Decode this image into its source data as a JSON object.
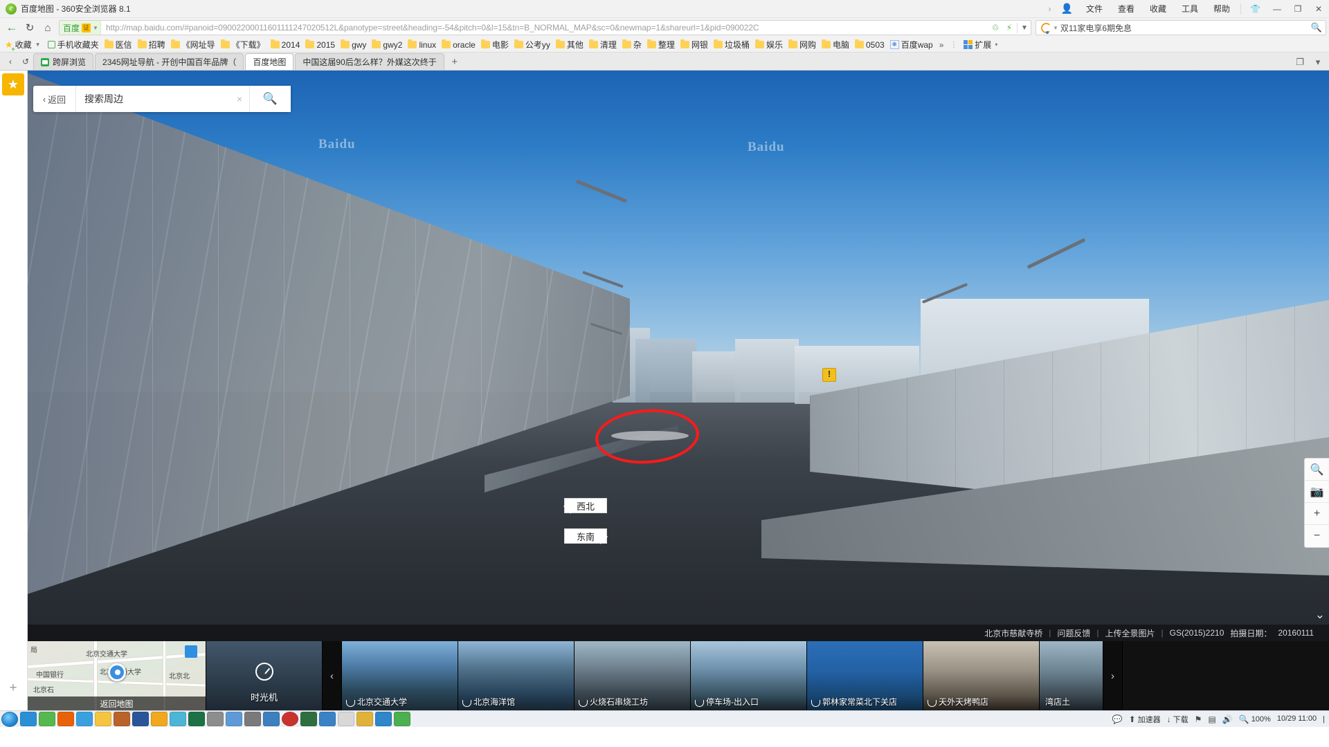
{
  "window": {
    "title": "百度地图 - 360安全浏览器 8.1",
    "app_icon": "ie-browser-icon",
    "menus": [
      "文件",
      "查看",
      "收藏",
      "工具",
      "帮助"
    ],
    "user_icon": "user-account-icon",
    "chevron": "›",
    "skin_icon": "shirt-skin-icon",
    "minimize": "—",
    "maximize": "❐",
    "close": "✕"
  },
  "nav": {
    "back_icon": "back-arrow-icon",
    "reload_icon": "reload-icon",
    "home_icon": "home-icon",
    "security_label": "百度",
    "security_badge": "证",
    "url_prefix": "http://map.",
    "url_domain": "baidu.com",
    "url_rest": "/#panoid=09002200011601111247020512L&panotype=street&heading=-54&pitch=0&l=15&tn=B_NORMAL_MAP&sc=0&newmap=1&shareurl=1&pid=090022C",
    "url_full": "http://map.baidu.com/#panoid=09002200011601111247020512L&panotype=street&heading=-54&pitch=0&l=15&tn=B_NORMAL_MAP&sc=0&newmap=1&shareurl=1&pid=090022C",
    "translate_icon": "translate-icon",
    "speed_icon": "lightning-icon",
    "dropdown_icon": "chevron-down-icon",
    "search_engine_icon": "baidu-logo-icon",
    "search_value": "双11家电享6期免息",
    "search_go_icon": "search-icon"
  },
  "bookmarks": {
    "favorites_label": "收藏",
    "favorites_icon": "star-icon",
    "caret_icon": "chevron-down-icon",
    "mobile_label": "手机收藏夹",
    "mobile_icon": "mobile-bookmark-icon",
    "items": [
      {
        "label": "医信",
        "icon": "folder-icon"
      },
      {
        "label": "招聘",
        "icon": "folder-icon"
      },
      {
        "label": "《网址导",
        "icon": "folder-icon"
      },
      {
        "label": "《下载》",
        "icon": "folder-icon"
      },
      {
        "label": "2014",
        "icon": "folder-icon"
      },
      {
        "label": "2015",
        "icon": "folder-icon"
      },
      {
        "label": "gwy",
        "icon": "folder-icon"
      },
      {
        "label": "gwy2",
        "icon": "folder-icon"
      },
      {
        "label": "linux",
        "icon": "folder-icon"
      },
      {
        "label": "oracle",
        "icon": "folder-icon"
      },
      {
        "label": "电影",
        "icon": "folder-icon"
      },
      {
        "label": "公考yy",
        "icon": "folder-icon"
      },
      {
        "label": "其他",
        "icon": "folder-icon"
      },
      {
        "label": "清理",
        "icon": "folder-icon"
      },
      {
        "label": "杂",
        "icon": "folder-icon"
      },
      {
        "label": "整理",
        "icon": "folder-icon"
      },
      {
        "label": "网银",
        "icon": "folder-icon"
      },
      {
        "label": "垃圾桶",
        "icon": "folder-icon"
      },
      {
        "label": "娱乐",
        "icon": "folder-icon"
      },
      {
        "label": "网购",
        "icon": "folder-icon"
      },
      {
        "label": "电脑",
        "icon": "folder-icon"
      },
      {
        "label": "0503",
        "icon": "folder-icon"
      },
      {
        "label": "百度wap",
        "icon": "baidu-site-icon"
      }
    ],
    "overflow_icon": "»",
    "extensions_label": "扩展",
    "extensions_icon": "extensions-icon",
    "extensions_caret": "▾"
  },
  "tabs": {
    "nav_left_icon": "tab-scroll-left-icon",
    "restore_icon": "restore-tab-icon",
    "items": [
      {
        "label": "跨屏浏览",
        "favicon": "crossscreen-icon",
        "active": false
      },
      {
        "label": "2345网址导航 - 开创中国百年品牌（",
        "favicon": "site-icon",
        "active": false
      },
      {
        "label": "百度地图",
        "favicon": "site-icon",
        "active": true
      },
      {
        "label": "中国这届90后怎么样？外媒这次终于",
        "favicon": "site-icon",
        "active": false
      }
    ],
    "new_tab_icon": "+",
    "right_icons": [
      "window-restore-icon",
      "tab-list-icon"
    ]
  },
  "map": {
    "search": {
      "back_label": "返回",
      "back_icon": "chevron-left-icon",
      "placeholder": "搜索周边",
      "value": "搜索周边",
      "clear_icon": "×",
      "go_icon": "search-icon"
    },
    "compass": {
      "nw_label": "西北",
      "se_label": "东南"
    },
    "watermark": [
      "Baidu",
      "Baidu"
    ],
    "warning_icon": "warning-triangle-icon",
    "annotation": "red-ellipse-annotation",
    "right_tools": [
      {
        "name": "search-tool",
        "icon": "🔍"
      },
      {
        "name": "camera-tool",
        "icon": "📷"
      },
      {
        "name": "zoom-in",
        "icon": "+"
      },
      {
        "name": "zoom-out",
        "icon": "−"
      },
      {
        "name": "collapse-down",
        "icon": "⌄"
      }
    ],
    "status": {
      "location": "北京市慈献寺桥",
      "feedback": "问题反馈",
      "upload": "上传全景图片",
      "license": "GS(2015)2210",
      "date_label": "拍摄日期：",
      "date_value": "20160111",
      "separator": "|"
    },
    "thumbnails": {
      "prev_icon": "‹",
      "next_icon": "›",
      "map_card": {
        "back_label": "返回地图",
        "labels": [
          "局",
          "北京交通大学",
          "中国银行",
          "北京交通大学",
          "北京北",
          "北京石"
        ],
        "badge_icon": "map-layer-badge"
      },
      "timemachine": {
        "label": "时光机",
        "icon": "clock-icon"
      },
      "items": [
        {
          "label": "北京交通大学",
          "icon": "panorama-icon"
        },
        {
          "label": "北京海洋馆",
          "icon": "panorama-icon"
        },
        {
          "label": "火烧石串烧工坊",
          "icon": "panorama-icon"
        },
        {
          "label": "停车场-出入口",
          "icon": "panorama-icon"
        },
        {
          "label": "郭林家常菜北下关店",
          "icon": "panorama-icon"
        },
        {
          "label": "天外天烤鸭店",
          "icon": "panorama-icon"
        },
        {
          "label": "湾店土",
          "icon": "panorama-icon"
        }
      ]
    }
  },
  "sidebar": {
    "favorite_icon": "star-badge-icon",
    "add_icon": "+"
  },
  "taskbar": {
    "start_icon": "start-orb-icon",
    "apps": [
      {
        "name": "ie-icon",
        "color": "#2b8fd6"
      },
      {
        "name": "chrome-icon",
        "color": "#56b94f"
      },
      {
        "name": "firefox-icon",
        "color": "#e8620a"
      },
      {
        "name": "qq-icon",
        "color": "#3aa0e0"
      },
      {
        "name": "explorer-icon",
        "color": "#f5c542"
      },
      {
        "name": "media-icon",
        "color": "#b9632a"
      },
      {
        "name": "word-icon",
        "color": "#2a5699"
      },
      {
        "name": "folder2-icon",
        "color": "#f0a81f"
      },
      {
        "name": "mail-icon",
        "color": "#4db5d6"
      },
      {
        "name": "excel-icon",
        "color": "#1e7145"
      },
      {
        "name": "volume-icon",
        "color": "#8d8d8d"
      },
      {
        "name": "shield-icon",
        "color": "#5d9ad6"
      },
      {
        "name": "calc-icon",
        "color": "#7a7a7a"
      },
      {
        "name": "chat-icon",
        "color": "#3d7fbf"
      },
      {
        "name": "record-icon",
        "color": "#c8332e"
      },
      {
        "name": "browser360-icon",
        "color": "#2f6f3f"
      },
      {
        "name": "player-icon",
        "color": "#3b82c4"
      },
      {
        "name": "notepad-icon",
        "color": "#d8d8d8"
      },
      {
        "name": "tool-icon",
        "color": "#e0b23a"
      },
      {
        "name": "globe-icon",
        "color": "#2f86c9"
      },
      {
        "name": "green-app-icon",
        "color": "#4caf50"
      }
    ],
    "tray": {
      "chat_icon": "💬",
      "accelerator_label": "加速器",
      "accelerator_icon": "🚀",
      "download_label": "下载",
      "download_icon": "↓",
      "flag_icon": "⚑",
      "net_icon": "🖧",
      "volume_icon": "🔊",
      "zoom_icon": "🔍",
      "zoom_value": "100%",
      "time": "11:00",
      "date": "10/29",
      "show_desktop": "|"
    }
  }
}
